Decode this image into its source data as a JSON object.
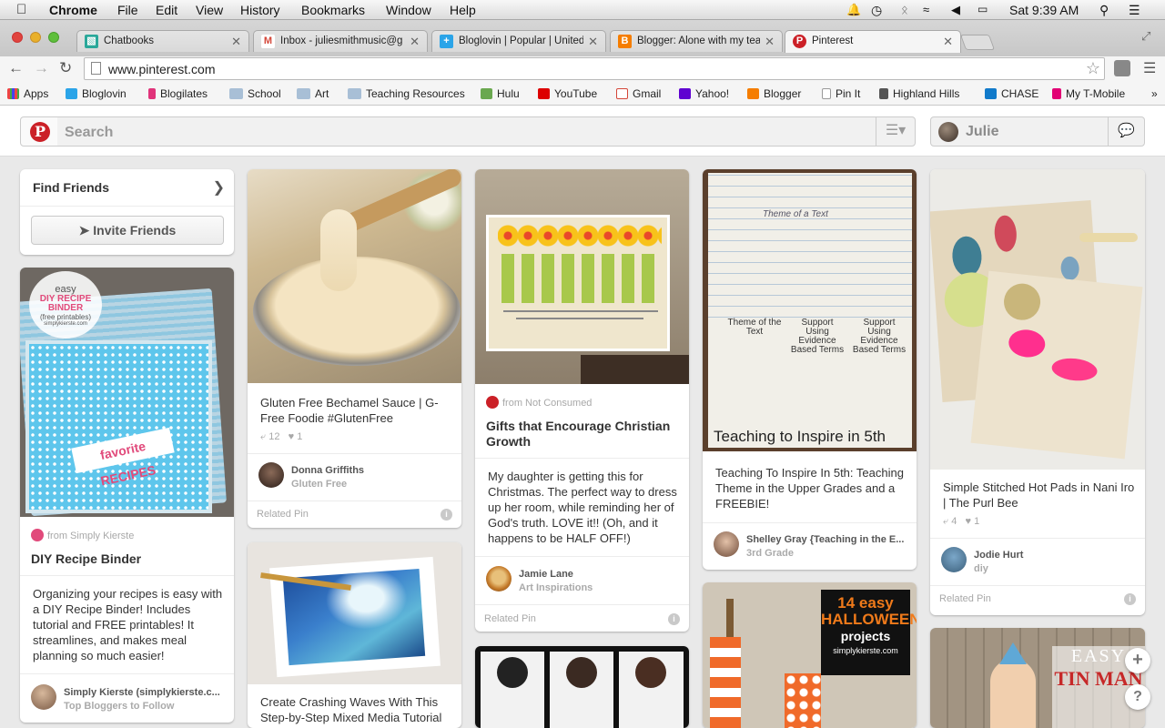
{
  "menubar": {
    "app": "Chrome",
    "items": [
      "File",
      "Edit",
      "View",
      "History",
      "Bookmarks",
      "Window",
      "Help"
    ],
    "clock": "Sat 9:39 AM"
  },
  "tabs": [
    {
      "title": "Chatbooks",
      "color": "#2aa89a"
    },
    {
      "title": "Inbox - juliesmithmusic@g",
      "color": "#d44638"
    },
    {
      "title": "Bloglovin | Popular | United",
      "color": "#2ba4e8"
    },
    {
      "title": "Blogger: Alone with my tea",
      "color": "#f57d00"
    },
    {
      "title": "Pinterest",
      "color": "#cb2027"
    }
  ],
  "toolbar": {
    "url": "www.pinterest.com"
  },
  "bookmarks": [
    {
      "label": "Apps",
      "color": "#e44"
    },
    {
      "label": "Bloglovin",
      "color": "#2ba4e8"
    },
    {
      "label": "Blogilates",
      "color": "#e0337a"
    },
    {
      "label": "School",
      "color": "#9ab"
    },
    {
      "label": "Art",
      "color": "#9ab"
    },
    {
      "label": "Teaching Resources",
      "color": "#9ab"
    },
    {
      "label": "Hulu",
      "color": "#6aa84f"
    },
    {
      "label": "YouTube",
      "color": "#d00"
    },
    {
      "label": "Gmail",
      "color": "#d44638"
    },
    {
      "label": "Yahoo!",
      "color": "#5f01d1"
    },
    {
      "label": "Blogger",
      "color": "#f57d00"
    },
    {
      "label": "Pin It",
      "color": "#ddd"
    },
    {
      "label": "Highland Hills",
      "color": "#555"
    },
    {
      "label": "CHASE",
      "color": "#117aca"
    },
    {
      "label": "My T-Mobile",
      "color": "#e20074"
    }
  ],
  "pinterest": {
    "logo": "P",
    "search_placeholder": "Search",
    "user_name": "Julie"
  },
  "find_friends": {
    "title": "Find Friends",
    "invite_button": "Invite Friends"
  },
  "pins": {
    "recipe_binder": {
      "img_text_1": "easy",
      "img_text_2": "DIY RECIPE BINDER",
      "img_text_3": "(free printables)",
      "img_text_4": "simplykierste.com",
      "img_text_5": "favorite RECIPES",
      "source": "from Simply Kierste",
      "title": "DIY Recipe Binder",
      "description": "Organizing your recipes is easy with a DIY Recipe Binder! Includes tutorial and FREE printables! It streamlines, and makes meal planning so much easier!",
      "pinner_name": "Simply Kierste (simplykierste.c...",
      "pinner_board": "Top Bloggers to Follow"
    },
    "bechamel": {
      "description": "Gluten Free Bechamel Sauce | G-Free Foodie #GlutenFree",
      "repins": "12",
      "likes": "1",
      "pinner_name": "Donna Griffiths",
      "pinner_board": "Gluten Free",
      "related": "Related Pin"
    },
    "waves": {
      "description": "Create Crashing Waves With This Step-by-Step Mixed Media Tutorial"
    },
    "gifts": {
      "source": "from Not Consumed",
      "title": "Gifts that Encourage Christian Growth",
      "description": "My daughter is getting this for Christmas. The perfect way to dress up her room, while reminding her of God's truth. LOVE it!! (Oh, and it happens to be HALF OFF!)",
      "pinner_name": "Jamie Lane",
      "pinner_board": "Art Inspirations",
      "related": "Related Pin"
    },
    "teaching": {
      "img_caption": "Teaching to Inspire in 5th",
      "img_col_1": "Theme of the Text",
      "img_col_2": "Support Using Evidence Based Terms",
      "img_col_3": "Support Using Evidence Based Terms",
      "img_title": "Theme of a Text",
      "description": "Teaching To Inspire In 5th: Teaching Theme in the Upper Grades and a FREEBIE!",
      "pinner_name": "Shelley Gray {Teaching in the E...",
      "pinner_board": "3rd Grade"
    },
    "halloween": {
      "line1": "14",
      "line2": "easy",
      "line3": "HALLOWEEN",
      "line4": "projects",
      "line5": "simplykierste.com"
    },
    "hotpads": {
      "description": "Simple Stitched Hot Pads in Nani Iro | The Purl Bee",
      "repins": "4",
      "likes": "1",
      "pinner_name": "Jodie Hurt",
      "pinner_board": "diy",
      "related": "Related Pin"
    },
    "tinman": {
      "img_text_1": "EASY",
      "img_text_2": "TIN MAN"
    }
  },
  "float_buttons": {
    "add": "+",
    "help": "?"
  }
}
